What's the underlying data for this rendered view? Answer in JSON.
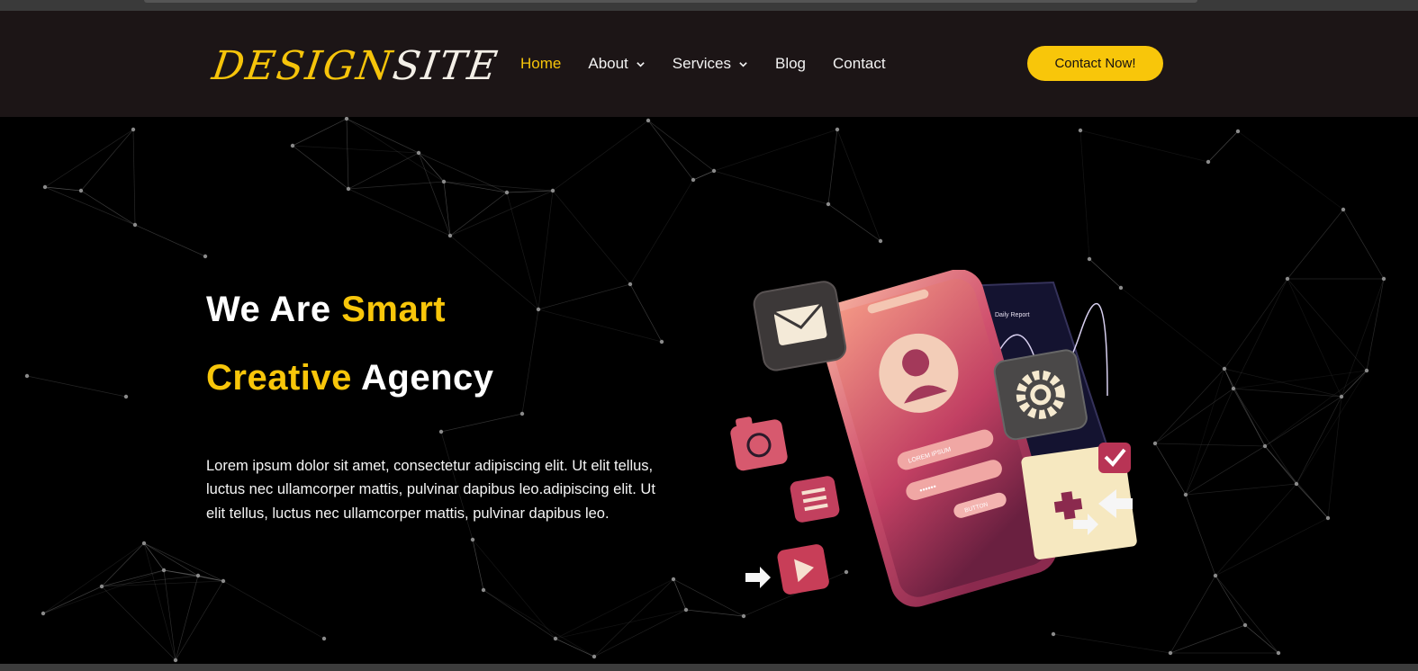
{
  "site": {
    "logo_part1": "DESIGN",
    "logo_part2": "SITE"
  },
  "nav": {
    "items": [
      {
        "label": "Home",
        "active": true,
        "dropdown": false
      },
      {
        "label": "About",
        "active": false,
        "dropdown": true
      },
      {
        "label": "Services",
        "active": false,
        "dropdown": true
      },
      {
        "label": "Blog",
        "active": false,
        "dropdown": false
      },
      {
        "label": "Contact",
        "active": false,
        "dropdown": false
      }
    ],
    "cta_label": "Contact Now!"
  },
  "hero": {
    "title_line1_plain": "We Are ",
    "title_line1_highlight": "Smart",
    "title_line2_highlight": "Creative",
    "title_line2_plain": " Agency",
    "description": "Lorem ipsum dolor sit amet, consectetur adipiscing elit. Ut elit tellus, luctus nec ullamcorper mattis, pulvinar dapibus leo.adipiscing elit. Ut elit tellus, luctus nec ullamcorper mattis, pulvinar dapibus leo."
  },
  "illustration": {
    "report_title": "Daily Report",
    "field_username": "LOREM IPSUM",
    "field_password": "••••••",
    "button_label": "BUTTON",
    "icons": [
      "mail-icon",
      "user-avatar-icon",
      "gear-icon",
      "camera-icon",
      "list-icon",
      "play-icon",
      "check-icon",
      "plus-icon",
      "arrow-icon"
    ]
  },
  "colors": {
    "accent": "#f8c60a",
    "nav_bg": "#1c1516",
    "page_bg": "#000000",
    "text": "#ffffff"
  }
}
